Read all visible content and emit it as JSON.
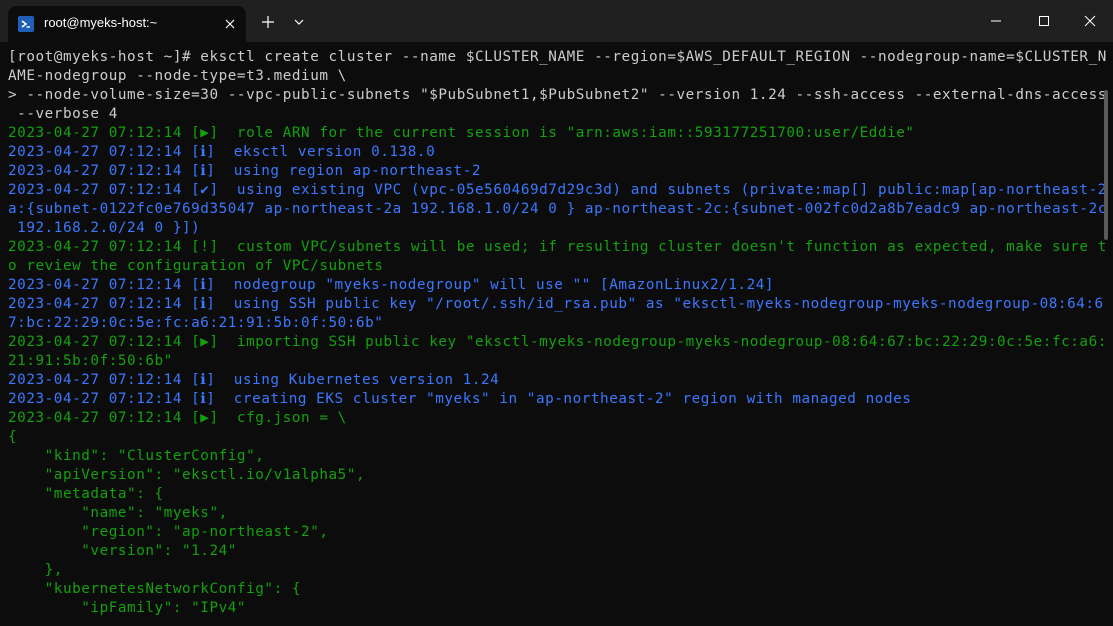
{
  "window": {
    "tab_title": "root@myeks-host:~",
    "icons": {
      "tab": "powershell-terminal-icon",
      "close_tab": "close-icon",
      "new_tab": "plus-icon",
      "dropdown": "chevron-down-icon",
      "minimize": "minimize-icon",
      "maximize": "maximize-icon",
      "close": "close-icon"
    }
  },
  "colors": {
    "background": "#0c0c0c",
    "titlebar": "#202020",
    "text": "#cccccc",
    "success": "#13a10e",
    "info": "#3b78ff",
    "warning_bracket": "#6f6f6f"
  },
  "terminal": {
    "lines": [
      {
        "color": "white",
        "text": "[root@myeks-host ~]# eksctl create cluster --name $CLUSTER_NAME --region=$AWS_DEFAULT_REGION --nodegroup-name=$CLUSTER_N"
      },
      {
        "color": "white",
        "text": "AME-nodegroup --node-type=t3.medium \\"
      },
      {
        "color": "white",
        "text": "> --node-volume-size=30 --vpc-public-subnets \"$PubSubnet1,$PubSubnet2\" --version 1.24 --ssh-access --external-dns-access"
      },
      {
        "color": "white",
        "text": " --verbose 4"
      },
      {
        "color": "green",
        "text": "2023-04-27 07:12:14 [▶]  role ARN for the current session is \"arn:aws:iam::593177251700:user/Eddie\""
      },
      {
        "color": "blue",
        "text": "2023-04-27 07:12:14 [ℹ]  eksctl version 0.138.0"
      },
      {
        "color": "blue",
        "text": "2023-04-27 07:12:14 [ℹ]  using region ap-northeast-2"
      },
      {
        "color": "blue",
        "text": "2023-04-27 07:12:14 [✔]  using existing VPC (vpc-05e560469d7d29c3d) and subnets (private:map[] public:map[ap-northeast-2"
      },
      {
        "color": "blue",
        "text": "a:{subnet-0122fc0e769d35047 ap-northeast-2a 192.168.1.0/24 0 } ap-northeast-2c:{subnet-002fc0d2a8b7eadc9 ap-northeast-2c"
      },
      {
        "color": "blue",
        "text": " 192.168.2.0/24 0 }])"
      },
      {
        "color": "green",
        "text": "2023-04-27 07:12:14 [!]  custom VPC/subnets will be used; if resulting cluster doesn't function as expected, make sure t"
      },
      {
        "color": "green",
        "text": "o review the configuration of VPC/subnets"
      },
      {
        "color": "blue",
        "text": "2023-04-27 07:12:14 [ℹ]  nodegroup \"myeks-nodegroup\" will use \"\" [AmazonLinux2/1.24]"
      },
      {
        "color": "blue",
        "text": "2023-04-27 07:12:14 [ℹ]  using SSH public key \"/root/.ssh/id_rsa.pub\" as \"eksctl-myeks-nodegroup-myeks-nodegroup-08:64:6"
      },
      {
        "color": "blue",
        "text": "7:bc:22:29:0c:5e:fc:a6:21:91:5b:0f:50:6b\""
      },
      {
        "color": "green",
        "text": "2023-04-27 07:12:14 [▶]  importing SSH public key \"eksctl-myeks-nodegroup-myeks-nodegroup-08:64:67:bc:22:29:0c:5e:fc:a6:"
      },
      {
        "color": "green",
        "text": "21:91:5b:0f:50:6b\""
      },
      {
        "color": "blue",
        "text": "2023-04-27 07:12:14 [ℹ]  using Kubernetes version 1.24"
      },
      {
        "color": "blue",
        "text": "2023-04-27 07:12:14 [ℹ]  creating EKS cluster \"myeks\" in \"ap-northeast-2\" region with managed nodes"
      },
      {
        "color": "green",
        "text": "2023-04-27 07:12:14 [▶]  cfg.json = \\"
      },
      {
        "color": "green",
        "text": "{"
      },
      {
        "color": "green",
        "text": "    \"kind\": \"ClusterConfig\","
      },
      {
        "color": "green",
        "text": "    \"apiVersion\": \"eksctl.io/v1alpha5\","
      },
      {
        "color": "green",
        "text": "    \"metadata\": {"
      },
      {
        "color": "green",
        "text": "        \"name\": \"myeks\","
      },
      {
        "color": "green",
        "text": "        \"region\": \"ap-northeast-2\","
      },
      {
        "color": "green",
        "text": "        \"version\": \"1.24\""
      },
      {
        "color": "green",
        "text": "    },"
      },
      {
        "color": "green",
        "text": "    \"kubernetesNetworkConfig\": {"
      },
      {
        "color": "green",
        "text": "        \"ipFamily\": \"IPv4\""
      }
    ]
  }
}
